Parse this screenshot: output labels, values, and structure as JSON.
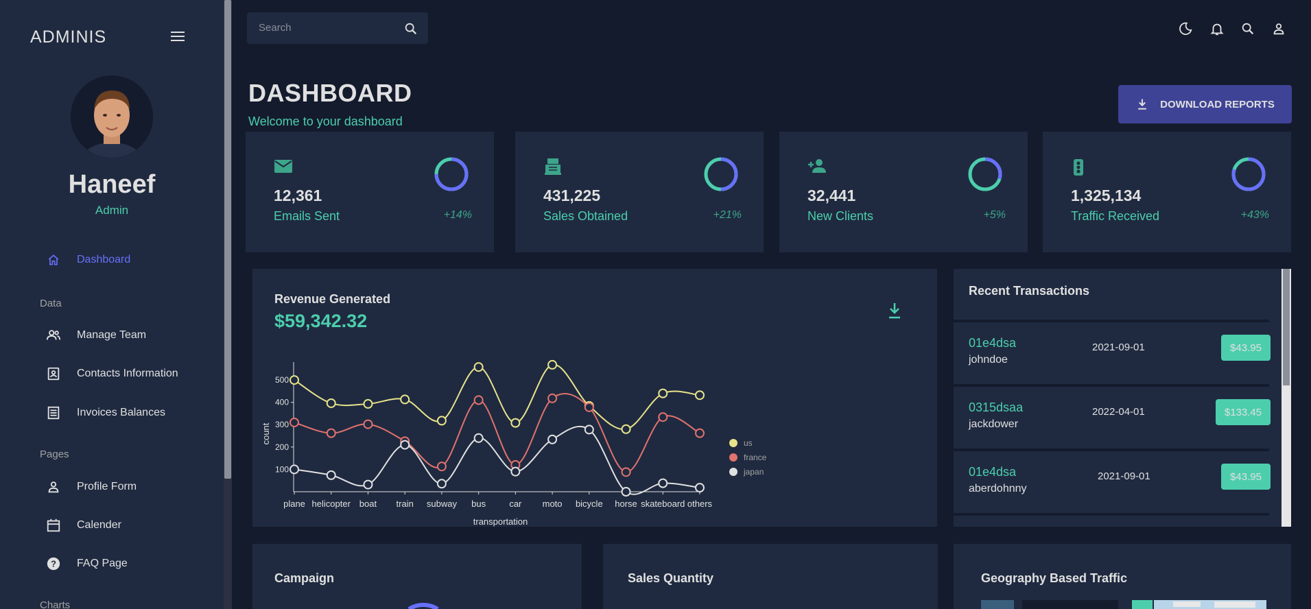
{
  "app": {
    "brand": "ADMINIS"
  },
  "user": {
    "name": "Haneef",
    "role": "Admin"
  },
  "sidebar": {
    "dashboard": "Dashboard",
    "section_data": "Data",
    "items_data": [
      "Manage Team",
      "Contacts Information",
      "Invoices Balances"
    ],
    "section_pages": "Pages",
    "items_pages": [
      "Profile Form",
      "Calender",
      "FAQ Page"
    ],
    "section_charts": "Charts"
  },
  "topbar": {
    "search_placeholder": "Search"
  },
  "header": {
    "title": "DASHBOARD",
    "subtitle": "Welcome to your dashboard",
    "download_label": "DOWNLOAD REPORTS"
  },
  "stats": [
    {
      "value": "12,361",
      "label": "Emails Sent",
      "increase": "+14%",
      "progress": 0.75,
      "icon": "email-icon"
    },
    {
      "value": "431,225",
      "label": "Sales Obtained",
      "increase": "+21%",
      "progress": 0.5,
      "icon": "point-of-sale-icon"
    },
    {
      "value": "32,441",
      "label": "New Clients",
      "increase": "+5%",
      "progress": 0.3,
      "icon": "person-add-icon"
    },
    {
      "value": "1,325,134",
      "label": "Traffic Received",
      "increase": "+43%",
      "progress": 0.8,
      "icon": "traffic-icon"
    }
  ],
  "revenue": {
    "title": "Revenue Generated",
    "amount": "$59,342.32"
  },
  "chart_data": {
    "type": "line",
    "categories": [
      "plane",
      "helicopter",
      "boat",
      "train",
      "subway",
      "bus",
      "car",
      "moto",
      "bicycle",
      "horse",
      "skateboard",
      "others"
    ],
    "xlabel": "transportation",
    "ylabel": "count",
    "yticks": [
      "100",
      "200",
      "300",
      "400",
      "500"
    ],
    "ylim": [
      0,
      580
    ],
    "series": [
      {
        "name": "us",
        "color": "#e8e38a",
        "values": [
          500,
          396,
          393,
          413,
          318,
          558,
          308,
          568,
          384,
          280,
          440,
          432
        ]
      },
      {
        "name": "france",
        "color": "#e2726e",
        "values": [
          310,
          262,
          302,
          226,
          113,
          410,
          120,
          418,
          378,
          88,
          334,
          262
        ]
      },
      {
        "name": "japan",
        "color": "#e0e0e0",
        "values": [
          100,
          74,
          32,
          210,
          36,
          240,
          90,
          234,
          278,
          0,
          38,
          18
        ]
      }
    ],
    "legend_position": "right"
  },
  "transactions": {
    "title": "Recent Transactions",
    "rows": [
      {
        "id": "01e4dsa",
        "user": "johndoe",
        "date": "2021-09-01",
        "cost": "$43.95"
      },
      {
        "id": "0315dsaa",
        "user": "jackdower",
        "date": "2022-04-01",
        "cost": "$133.45"
      },
      {
        "id": "01e4dsa",
        "user": "aberdohnny",
        "date": "2021-09-01",
        "cost": "$43.95"
      }
    ]
  },
  "bottom": {
    "campaign": "Campaign",
    "sales_quantity": "Sales Quantity",
    "geography": "Geography Based Traffic"
  },
  "colors": {
    "accent": "#4cceac",
    "primary": "#3e4396",
    "blue_active": "#6870fa"
  }
}
